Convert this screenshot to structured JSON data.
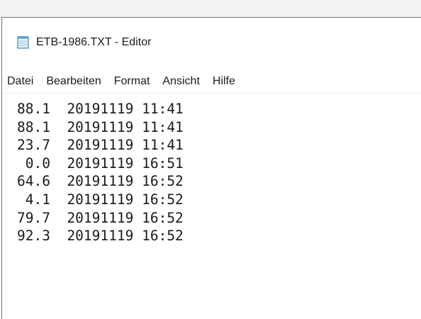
{
  "window": {
    "title": "ETB-1986.TXT - Editor"
  },
  "menu": {
    "items": [
      "Datei",
      "Bearbeiten",
      "Format",
      "Ansicht",
      "Hilfe"
    ]
  },
  "editor": {
    "lines": [
      "88.1  20191119 11:41",
      "88.1  20191119 11:41",
      "23.7  20191119 11:41",
      " 0.0  20191119 16:51",
      "64.6  20191119 16:52",
      " 4.1  20191119 16:52",
      "79.7  20191119 16:52",
      "92.3  20191119 16:52"
    ]
  },
  "icons": {
    "app": "notepad-icon"
  }
}
